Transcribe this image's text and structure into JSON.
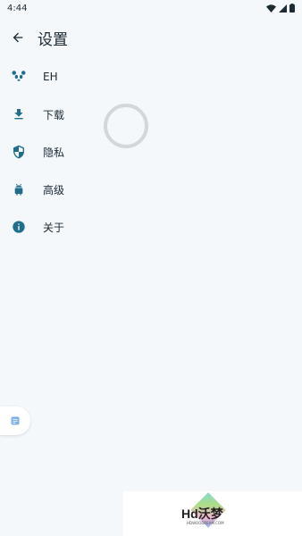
{
  "status": {
    "time": "4:44"
  },
  "header": {
    "title": "设置"
  },
  "menu": {
    "items": [
      {
        "label": "EH",
        "icon": "panda-icon"
      },
      {
        "label": "下载",
        "icon": "download-icon"
      },
      {
        "label": "隐私",
        "icon": "shield-icon"
      },
      {
        "label": "高级",
        "icon": "android-icon"
      },
      {
        "label": "关于",
        "icon": "info-icon"
      }
    ]
  },
  "watermark": {
    "text": "Hd沃梦",
    "subtext": "HDWOODREAM.COM"
  },
  "colors": {
    "accent": "#1f6e8c",
    "background": "#f4f8fb",
    "spinner": "#d3d7da"
  }
}
